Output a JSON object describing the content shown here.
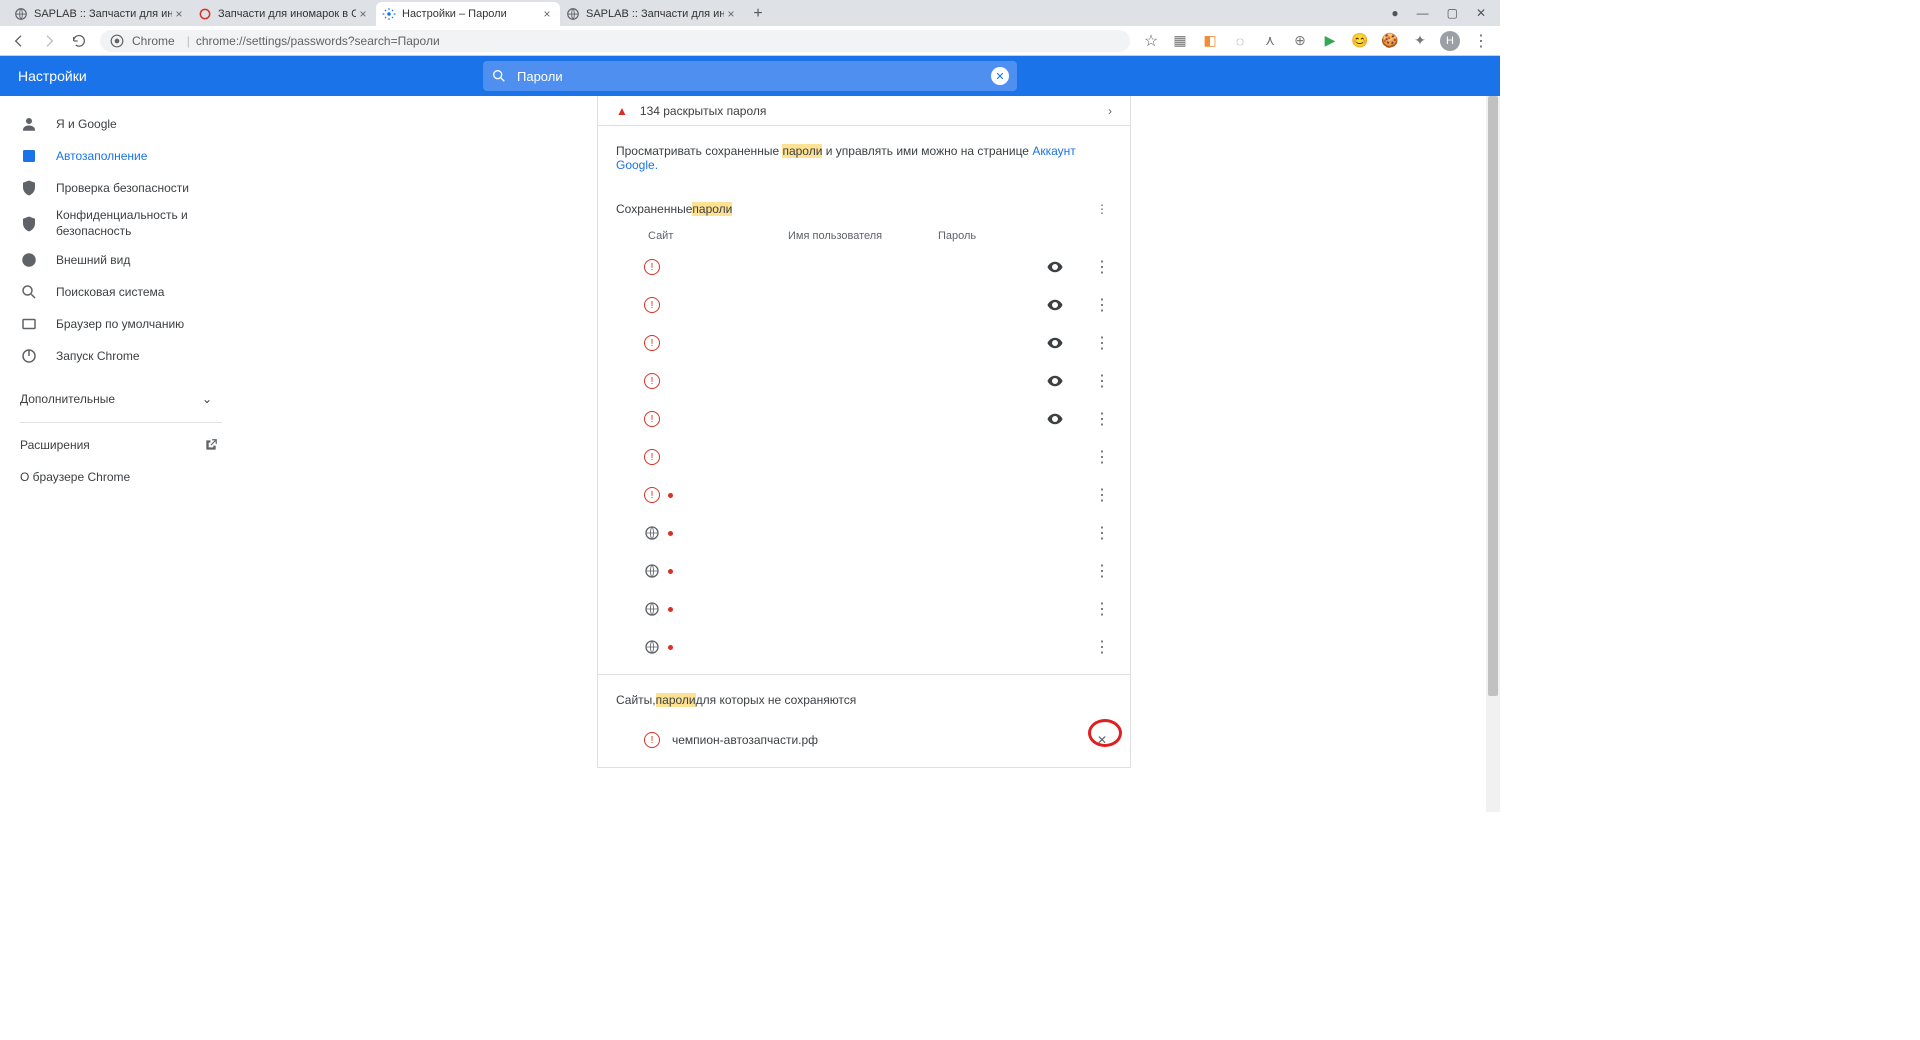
{
  "tabs": [
    {
      "title": "SAPLAB :: Запчасти для иномар…",
      "favicon": "globe"
    },
    {
      "title": "Запчасти для иномарок в Сара…",
      "favicon": "red"
    },
    {
      "title": "Настройки – Пароли",
      "favicon": "gear",
      "active": true
    },
    {
      "title": "SAPLAB :: Запчасти для иномар…",
      "favicon": "globe"
    }
  ],
  "address": {
    "scheme_label": "Chrome",
    "url": "chrome://settings/passwords?search=Пароли"
  },
  "avatar_letter": "Н",
  "blue_bar_title": "Настройки",
  "search_value": "Пароли",
  "sidebar": {
    "items": [
      {
        "label": "Я и Google",
        "icon": "person"
      },
      {
        "label": "Автозаполнение",
        "icon": "autofill",
        "selected": true
      },
      {
        "label": "Проверка безопасности",
        "icon": "shield"
      },
      {
        "label": "Конфиденциальность и безопасность",
        "icon": "shield"
      },
      {
        "label": "Внешний вид",
        "icon": "palette"
      },
      {
        "label": "Поисковая система",
        "icon": "search"
      },
      {
        "label": "Браузер по умолчанию",
        "icon": "square"
      },
      {
        "label": "Запуск Chrome",
        "icon": "power"
      }
    ],
    "advanced_label": "Дополнительные",
    "extensions_label": "Расширения",
    "about_label": "О браузере Chrome"
  },
  "content": {
    "alert_text": "134 раскрытых пароля",
    "info_prefix": "Просматривать сохраненные ",
    "info_hl": "пароли",
    "info_suffix": " и управлять ими можно на странице  ",
    "info_link": "Аккаунт Google.",
    "saved_section_prefix": "Сохраненные ",
    "saved_section_hl": "пароли",
    "columns": {
      "site": "Сайт",
      "user": "Имя пользователя",
      "pass": "Пароль"
    },
    "password_rows": [
      {
        "icon": "red",
        "eye": true
      },
      {
        "icon": "red",
        "eye": true
      },
      {
        "icon": "red",
        "eye": true
      },
      {
        "icon": "red",
        "eye": true
      },
      {
        "icon": "red",
        "eye": true
      },
      {
        "icon": "red",
        "eye": false
      },
      {
        "icon": "red",
        "eye": false,
        "dot": true
      },
      {
        "icon": "grey",
        "eye": false,
        "dot": true
      },
      {
        "icon": "grey",
        "eye": false,
        "dot": true
      },
      {
        "icon": "grey",
        "eye": false,
        "dot": true
      },
      {
        "icon": "grey",
        "eye": false,
        "dot": true
      }
    ],
    "never_prefix": "Сайты, ",
    "never_hl": "пароли",
    "never_suffix": " для которых не сохраняются",
    "never_site": "чемпион-автозапчасти.рф"
  }
}
